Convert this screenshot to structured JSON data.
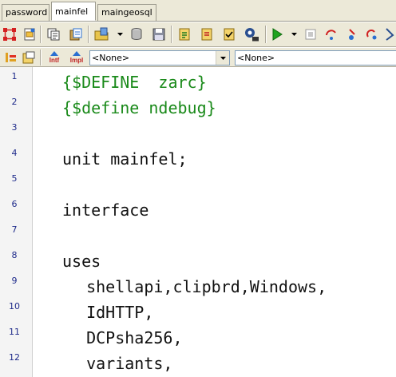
{
  "tabs": [
    {
      "label": "password",
      "active": false
    },
    {
      "label": "mainfel",
      "active": true
    },
    {
      "label": "maingeosql",
      "active": false
    }
  ],
  "toolbar_row2": {
    "interface_label": "Intf",
    "implementation_label": "Impl",
    "class_combo_value": "<None>",
    "method_combo_value": "<None>"
  },
  "editor": {
    "line_numbers": [
      "1",
      "2",
      "3",
      "4",
      "5",
      "6",
      "7",
      "8",
      "9",
      "10",
      "11",
      "12"
    ],
    "lines": [
      {
        "text": "{$DEFINE  zarc}",
        "kind": "directive"
      },
      {
        "text": "{$define ndebug}",
        "kind": "directive"
      },
      {
        "text": "",
        "kind": "code"
      },
      {
        "text": "unit mainfel;",
        "kind": "code"
      },
      {
        "text": "",
        "kind": "code"
      },
      {
        "text": "interface",
        "kind": "code"
      },
      {
        "text": "",
        "kind": "code"
      },
      {
        "text": "uses",
        "kind": "code"
      },
      {
        "text": "  shellapi,clipbrd,Windows,",
        "kind": "code"
      },
      {
        "text": "  IdHTTP,",
        "kind": "code"
      },
      {
        "text": "  DCPsha256,",
        "kind": "code"
      },
      {
        "text": "  variants,",
        "kind": "code"
      }
    ]
  },
  "colors": {
    "directive": "#1a8a1a",
    "code": "#111111",
    "line_number": "#1e2a8a",
    "run_green": "#1fa31f",
    "toolbar_bg": "#ece9d8"
  },
  "icons": {
    "row1": [
      "structure-icon",
      "open-project-icon",
      "copy-icon",
      "paste-icon",
      "open-folder-icon",
      "database-icon",
      "save-icon",
      "new-unit-icon",
      "new-form-icon",
      "checklist-icon",
      "component-icon",
      "run-icon",
      "step-icon",
      "trace-icon",
      "debug-icon",
      "stop-icon",
      "arrow-icon"
    ],
    "row2": [
      "toggle-icon",
      "open-icon",
      "interface-icon",
      "implementation-icon"
    ]
  }
}
